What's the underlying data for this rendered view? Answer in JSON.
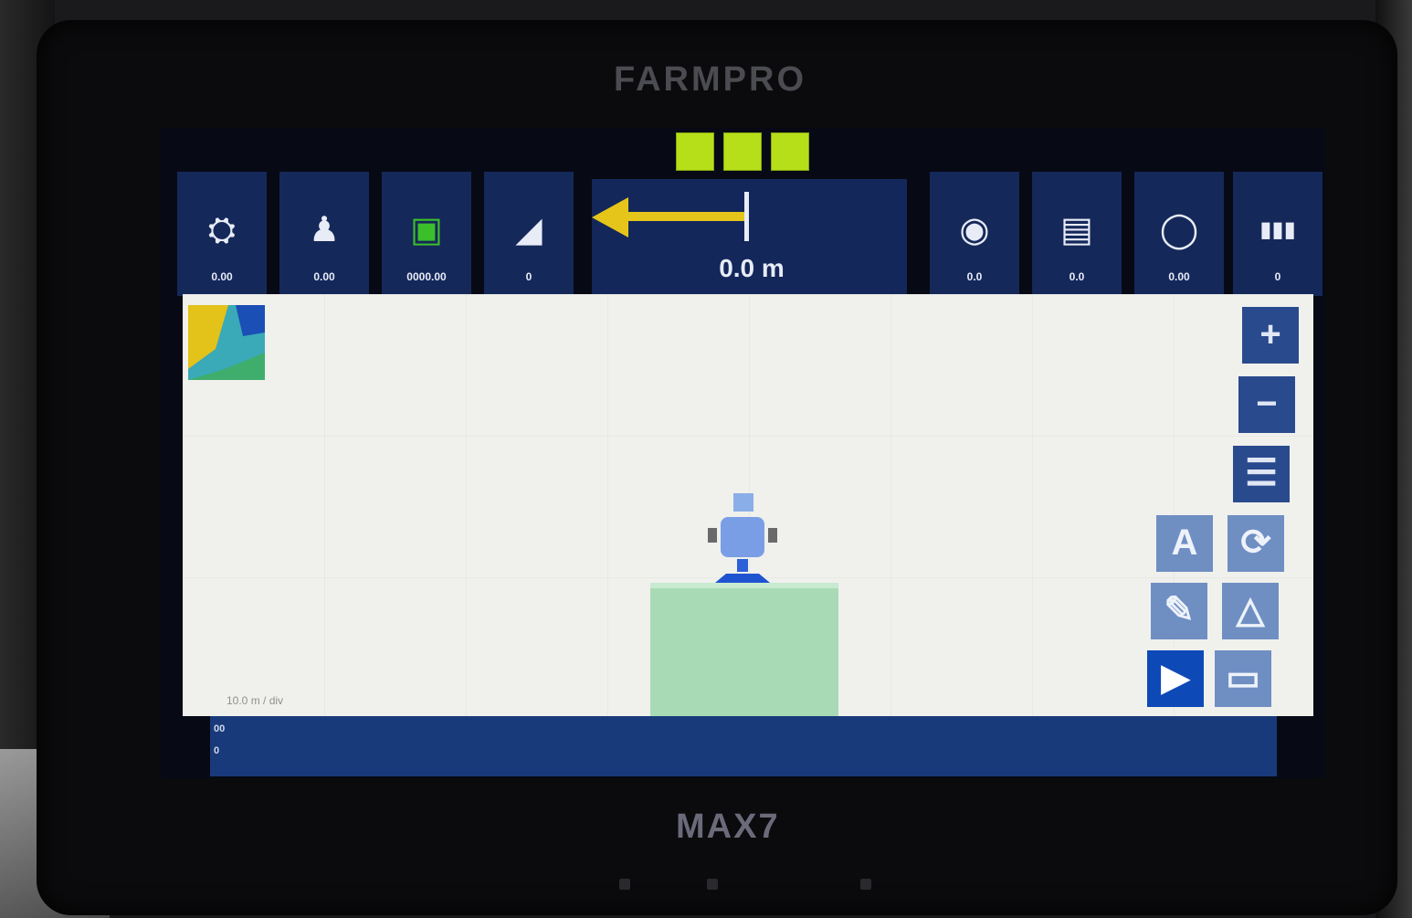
{
  "device": {
    "brand": "FARMPRO",
    "model": "MAX7"
  },
  "status_leds": {
    "count": 3,
    "color": "#b6df1a"
  },
  "toolbar": {
    "tiles_left": [
      {
        "icon": "sprayer-icon",
        "glyph": "⛭",
        "label": "0.00"
      },
      {
        "icon": "nozzle-icon",
        "glyph": "♟",
        "label": "0.00"
      },
      {
        "icon": "section-control-icon",
        "glyph": "▣",
        "label": "0000.00"
      },
      {
        "icon": "terrain-icon",
        "glyph": "◢",
        "label": "0"
      }
    ],
    "guidance": {
      "direction": "left",
      "offset": "0.0 m"
    },
    "tiles_right": [
      {
        "icon": "speed-gauge-icon",
        "glyph": "◉",
        "label": "0.0"
      },
      {
        "icon": "field-record-icon",
        "glyph": "▤",
        "label": "0.0"
      },
      {
        "icon": "gps-signal-icon",
        "glyph": "◯",
        "label": "0.00"
      },
      {
        "icon": "boom-sections-icon",
        "glyph": "▮▮▮",
        "label": "0"
      }
    ]
  },
  "map": {
    "scale_text": "10.0 m / div"
  },
  "side_controls": [
    {
      "name": "zoom-in-button",
      "glyph": "+"
    },
    {
      "name": "zoom-out-button",
      "glyph": "−"
    },
    {
      "name": "menu-button",
      "glyph": "☰"
    },
    {
      "name": "auto-steer-button",
      "glyph": "A"
    },
    {
      "name": "rotate-view-button",
      "glyph": "⟳"
    },
    {
      "name": "edit-line-button",
      "glyph": "✎"
    },
    {
      "name": "boundary-button",
      "glyph": "△"
    },
    {
      "name": "play-button",
      "glyph": "▶"
    },
    {
      "name": "settings-panel-button",
      "glyph": "▭"
    }
  ],
  "bottombar": {
    "line1": "00",
    "line2": "0"
  },
  "colors": {
    "panel": "#15285a",
    "map_bg": "#f0f0ec",
    "coverage": "#a8dbb5",
    "guidance_arrow": "#e5c51a"
  }
}
